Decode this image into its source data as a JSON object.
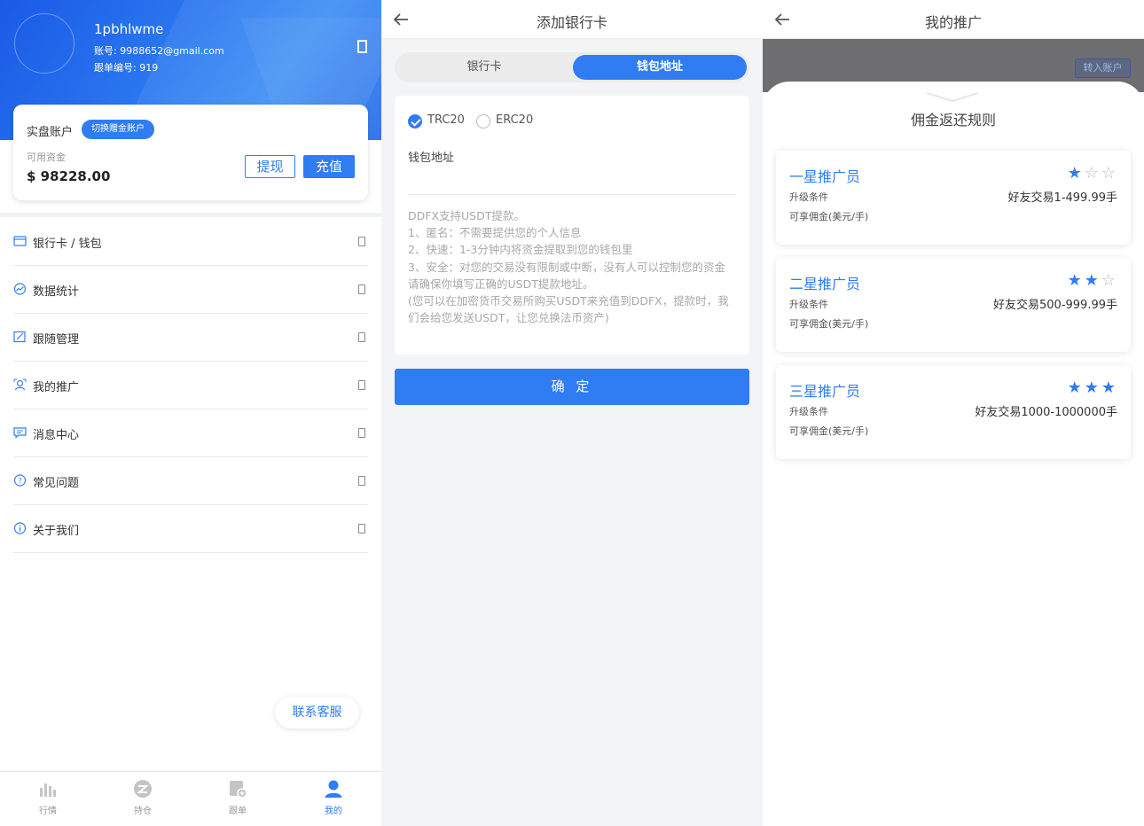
{
  "screen1": {
    "username": "1pbhlwme",
    "account_line": "账号: 9988652@gmail.com",
    "follow_line": "跟单编号: 919",
    "card": {
      "title": "实盘账户",
      "switch_label": "切换赠金账户",
      "available_label": "可用资金",
      "available_value": "$ 98228.00",
      "withdraw_label": "提现",
      "recharge_label": "充值"
    },
    "menu": [
      {
        "label": "银行卡 / 钱包",
        "icon": "card-icon"
      },
      {
        "label": "数据统计",
        "icon": "stats-icon"
      },
      {
        "label": "跟随管理",
        "icon": "edit-icon"
      },
      {
        "label": "我的推广",
        "icon": "promote-icon"
      },
      {
        "label": "消息中心",
        "icon": "message-icon"
      },
      {
        "label": "常见问题",
        "icon": "question-icon"
      },
      {
        "label": "关于我们",
        "icon": "info-icon"
      }
    ],
    "contact_label": "联系客服",
    "tabs": [
      {
        "label": "行情",
        "icon": "chart-bars-icon"
      },
      {
        "label": "持仓",
        "icon": "position-icon"
      },
      {
        "label": "跟单",
        "icon": "follow-order-icon"
      },
      {
        "label": "我的",
        "icon": "user-icon"
      }
    ],
    "active_tab": "我的"
  },
  "screen2": {
    "title": "添加银行卡",
    "segments": [
      "银行卡",
      "钱包地址"
    ],
    "active_segment": "钱包地址",
    "networks": [
      {
        "label": "TRC20",
        "checked": true
      },
      {
        "label": "ERC20",
        "checked": false
      }
    ],
    "wallet_label": "钱包地址",
    "wallet_value": "",
    "notes": [
      "DDFX支持USDT提款。",
      "1、匿名：不需要提供您的个人信息",
      "2、快速：1-3分钟内将资金提取到您的钱包里",
      "3、安全：对您的交易没有限制或中断，没有人可以控制您的资金",
      "请确保你填写正确的USDT提款地址。",
      "(您可以在加密货币交易所购买USDT来充值到DDFX，提款时，我们会给您发送USDT，让您兑换法币资产)"
    ],
    "confirm_label": "确 定"
  },
  "screen3": {
    "title": "我的推广",
    "transfer_label": "转入账户",
    "sheet_title": "佣金返还规则",
    "tiers": [
      {
        "name": "一星推广员",
        "stars": 1,
        "cond_label": "升级条件",
        "cond_value": "好友交易1-499.99手",
        "commission_label": "可享佣金(美元/手)"
      },
      {
        "name": "二星推广员",
        "stars": 2,
        "cond_label": "升级条件",
        "cond_value": "好友交易500-999.99手",
        "commission_label": "可享佣金(美元/手)"
      },
      {
        "name": "三星推广员",
        "stars": 3,
        "cond_label": "升级条件",
        "cond_value": "好友交易1000-1000000手",
        "commission_label": "可享佣金(美元/手)"
      }
    ]
  },
  "colors": {
    "accent": "#2f7cf3",
    "header_gradient_start": "#1a5ae6",
    "overlay": "#6e6e70"
  }
}
